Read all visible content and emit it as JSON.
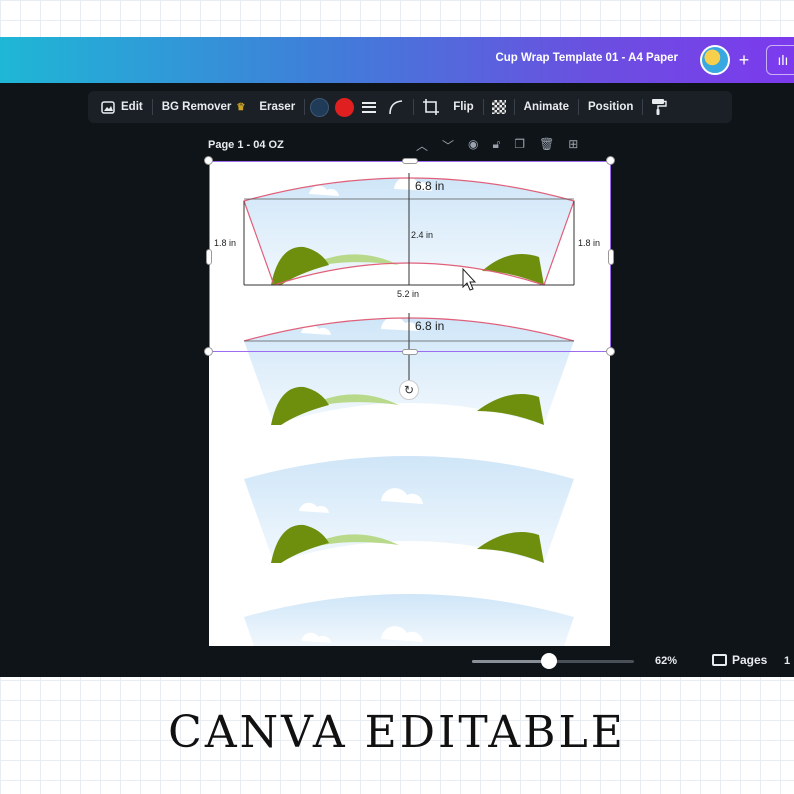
{
  "app": {
    "document_title": "Cup Wrap Template 01 - A4 Paper",
    "plus_label": "+",
    "stats_label": "ılı"
  },
  "toolbar": {
    "edit_label": "Edit",
    "bg_remover_label": "BG Remover",
    "eraser_label": "Eraser",
    "flip_label": "Flip",
    "animate_label": "Animate",
    "position_label": "Position",
    "colors": [
      "#1f3b57",
      "#e02020"
    ]
  },
  "page": {
    "label": "Page 1 - 04 OZ"
  },
  "template": {
    "top_width": "6.8 in",
    "height": "2.4 in",
    "side_left": "1.8 in",
    "side_right": "1.8 in",
    "bottom_width": "5.2 in",
    "second_top_width": "6.8 in"
  },
  "bottom_bar": {
    "zoom_value": 0.62,
    "zoom_label": "62%",
    "pages_label": "Pages",
    "pages_count": "1"
  },
  "caption": "CANVA EDITABLE",
  "colors": {
    "accent_selection": "#9b6bf2",
    "sky": "#d4e9f9",
    "hill_dark": "#6e8f0e",
    "hill_light": "#b8d98a",
    "guide_red": "#e0607a"
  }
}
